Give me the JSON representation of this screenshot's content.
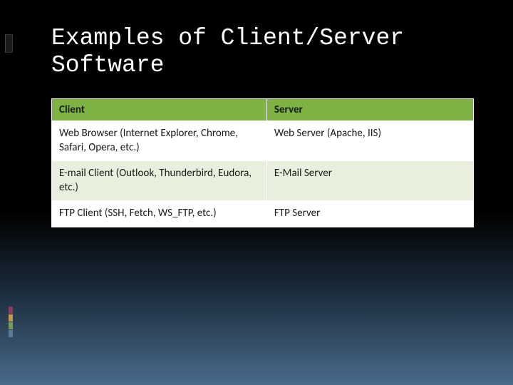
{
  "title": "Examples of Client/Server Software",
  "table": {
    "headers": {
      "client": "Client",
      "server": "Server"
    },
    "rows": [
      {
        "client": "Web Browser (Internet Explorer, Chrome, Safari, Opera, etc.)",
        "server": "Web Server (Apache, IIS)"
      },
      {
        "client": "E-mail Client (Outlook, Thunderbird, Eudora, etc.)",
        "server": "E-Mail Server"
      },
      {
        "client": "FTP Client (SSH, Fetch, WS_FTP, etc.)",
        "server": "FTP Server"
      }
    ]
  }
}
